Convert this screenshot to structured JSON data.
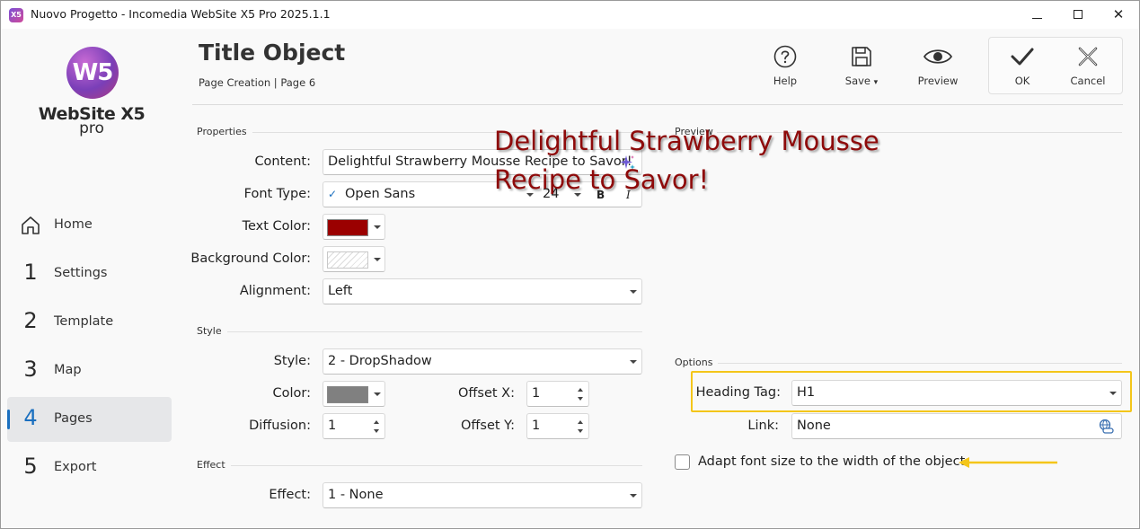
{
  "window": {
    "title": "Nuovo Progetto - Incomedia WebSite X5 Pro 2025.1.1",
    "app_icon_text": "X5",
    "minimize_icon": "minimize-icon",
    "maximize_icon": "maximize-icon",
    "close_icon": "close-icon",
    "close_glyph": "✕"
  },
  "sidebar": {
    "logo_mark": "W5",
    "logo_text": "WebSite X5",
    "logo_sub": "pro",
    "items": [
      {
        "num": "",
        "label": "Home",
        "icon": "home-icon",
        "active": false
      },
      {
        "num": "1",
        "label": "Settings",
        "active": false
      },
      {
        "num": "2",
        "label": "Template",
        "active": false
      },
      {
        "num": "3",
        "label": "Map",
        "active": false
      },
      {
        "num": "4",
        "label": "Pages",
        "active": true
      },
      {
        "num": "5",
        "label": "Export",
        "active": false
      }
    ]
  },
  "header": {
    "title": "Title Object",
    "breadcrumb": "Page Creation | Page 6",
    "toolbar": {
      "help": "Help",
      "save": "Save",
      "save_caret": "▾",
      "preview": "Preview",
      "ok": "OK",
      "cancel": "Cancel"
    }
  },
  "properties": {
    "section": "Properties",
    "content_label": "Content:",
    "content_value": "Delightful Strawberry Mousse Recipe to Savor!",
    "font_label": "Font Type:",
    "font_check": "✓",
    "font_value": "Open Sans",
    "font_size": "24",
    "bold": "B",
    "italic": "I",
    "text_color_label": "Text Color:",
    "text_color": "#9b0000",
    "bg_color_label": "Background Color:",
    "alignment_label": "Alignment:",
    "alignment_value": "Left"
  },
  "style": {
    "section": "Style",
    "style_label": "Style:",
    "style_value": "2 - DropShadow",
    "color_label": "Color:",
    "shadow_color": "#808080",
    "diffusion_label": "Diffusion:",
    "diffusion_value": "1",
    "offset_x_label": "Offset X:",
    "offset_x_value": "1",
    "offset_y_label": "Offset Y:",
    "offset_y_value": "1"
  },
  "effect": {
    "section": "Effect",
    "effect_label": "Effect:",
    "effect_value": "1 - None"
  },
  "preview": {
    "section": "Preview",
    "text": "Delightful Strawberry Mousse Recipe to Savor!",
    "color": "#8e0a0a"
  },
  "options": {
    "section": "Options",
    "heading_label": "Heading Tag:",
    "heading_value": "H1",
    "link_label": "Link:",
    "link_value": "None",
    "adapt_label": "Adapt font size to the width of the object",
    "adapt_checked": false
  },
  "colors": {
    "accent": "#1a6fbf",
    "highlight": "#f4c61a"
  }
}
